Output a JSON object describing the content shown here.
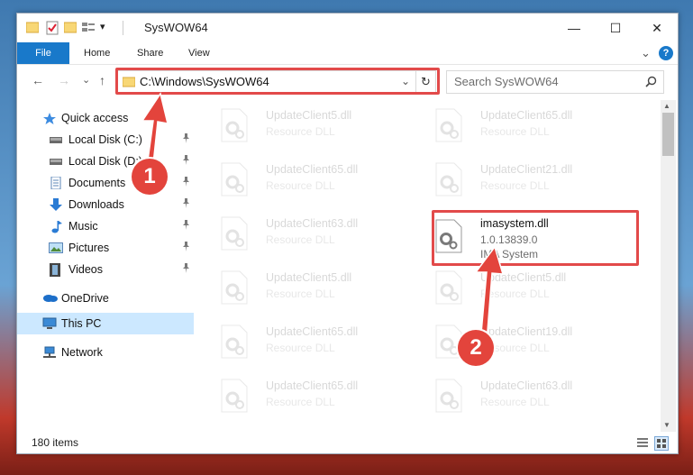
{
  "window": {
    "title": "SysWOW64"
  },
  "window_controls": {
    "minimize": "—",
    "maximize": "☐",
    "close": "✕"
  },
  "ribbon": {
    "file": "File",
    "home": "Home",
    "share": "Share",
    "view": "View",
    "expand": "⌄",
    "help": "?"
  },
  "nav_buttons": {
    "back": "←",
    "forward": "→",
    "recent": "⌄",
    "up": "↑"
  },
  "address": {
    "path": "C:\\Windows\\SysWOW64",
    "dropdown": "⌄",
    "refresh": "↻"
  },
  "search": {
    "placeholder": "Search SysWOW64"
  },
  "sidebar": {
    "items": [
      {
        "label": "Quick access"
      },
      {
        "label": "Local Disk (C:)"
      },
      {
        "label": "Local Disk (D:)"
      },
      {
        "label": "Documents"
      },
      {
        "label": "Downloads"
      },
      {
        "label": "Music"
      },
      {
        "label": "Pictures"
      },
      {
        "label": "Videos"
      },
      {
        "label": "OneDrive"
      },
      {
        "label": "This PC"
      },
      {
        "label": "Network"
      }
    ],
    "pin": "📌"
  },
  "files": [
    {
      "name": "UpdateClient5.dll",
      "sub": "Resource DLL"
    },
    {
      "name": "UpdateClient65.dll",
      "sub": "Resource DLL"
    },
    {
      "name": "UpdateClient65.dll",
      "sub": "Resource DLL"
    },
    {
      "name": "UpdateClient21.dll",
      "sub": "Resource DLL"
    },
    {
      "name": "UpdateClient63.dll",
      "sub": "Resource DLL"
    },
    {
      "name": "imasystem.dll",
      "version": "1.0.13839.0",
      "company": "IMA System"
    },
    {
      "name": "UpdateClient5.dll",
      "sub": "Resource DLL"
    },
    {
      "name": "UpdateClient5.dll",
      "sub": "Resource DLL"
    },
    {
      "name": "UpdateClient65.dll",
      "sub": "Resource DLL"
    },
    {
      "name": "UpdateClient19.dll",
      "sub": "Resource DLL"
    },
    {
      "name": "UpdateClient65.dll",
      "sub": "Resource DLL"
    },
    {
      "name": "UpdateClient63.dll",
      "sub": "Resource DLL"
    }
  ],
  "status": {
    "count": "180 items"
  },
  "annotations": {
    "step1": "1",
    "step2": "2"
  },
  "colors": {
    "accent": "#1979ca",
    "highlight": "#e24a4a",
    "selected": "#cce8ff"
  }
}
